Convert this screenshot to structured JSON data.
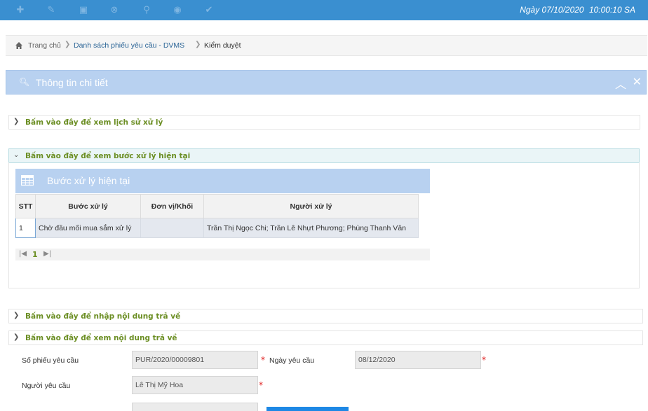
{
  "toolbar": {
    "icons": [
      "add-icon",
      "edit-icon",
      "save-icon",
      "cancel-icon",
      "search-icon",
      "view-icon",
      "approve-icon"
    ],
    "date_label": "Ngày 07/10/2020",
    "time_label": "10:00:10 SA",
    "colors": {
      "bar": "#3a8fd0",
      "icon": "#7fb6e2"
    }
  },
  "breadcrumb": {
    "home": "Trang chủ",
    "list": "Danh sách phiếu yêu cầu - DVMS",
    "current": "Kiểm duyệt"
  },
  "panel": {
    "title": "Thông tin chi tiết"
  },
  "accordions": {
    "history": "Bấm vào đây để xem lịch sử xử lý",
    "current_step": "Bấm vào đây để xem bước xử lý hiện tại",
    "enter_return": "Bấm vào đây để nhập nội dung trả về",
    "view_return": "Bấm vào đây để xem nội dung trả về"
  },
  "step_grid": {
    "title": "Bước xử lý hiện tại",
    "columns": [
      "STT",
      "Bước xử lý",
      "Đơn vị/Khối",
      "Người xử lý"
    ],
    "rows": [
      [
        "1",
        "Chờ đầu mối mua sắm xử lý",
        "",
        "Trần Thị Ngọc Chi; Trần Lê Nhựt Phương; Phùng Thanh Vân"
      ]
    ],
    "pager": {
      "page": "1"
    }
  },
  "form": {
    "request_no_label": "Số phiếu yêu cầu",
    "request_no_value": "PUR/2020/00009801",
    "request_date_label": "Ngày yêu cầu",
    "request_date_value": "08/12/2020",
    "requester_label": "Người yêu cầu",
    "requester_value": "Lê Thị Mỹ Hoa"
  }
}
